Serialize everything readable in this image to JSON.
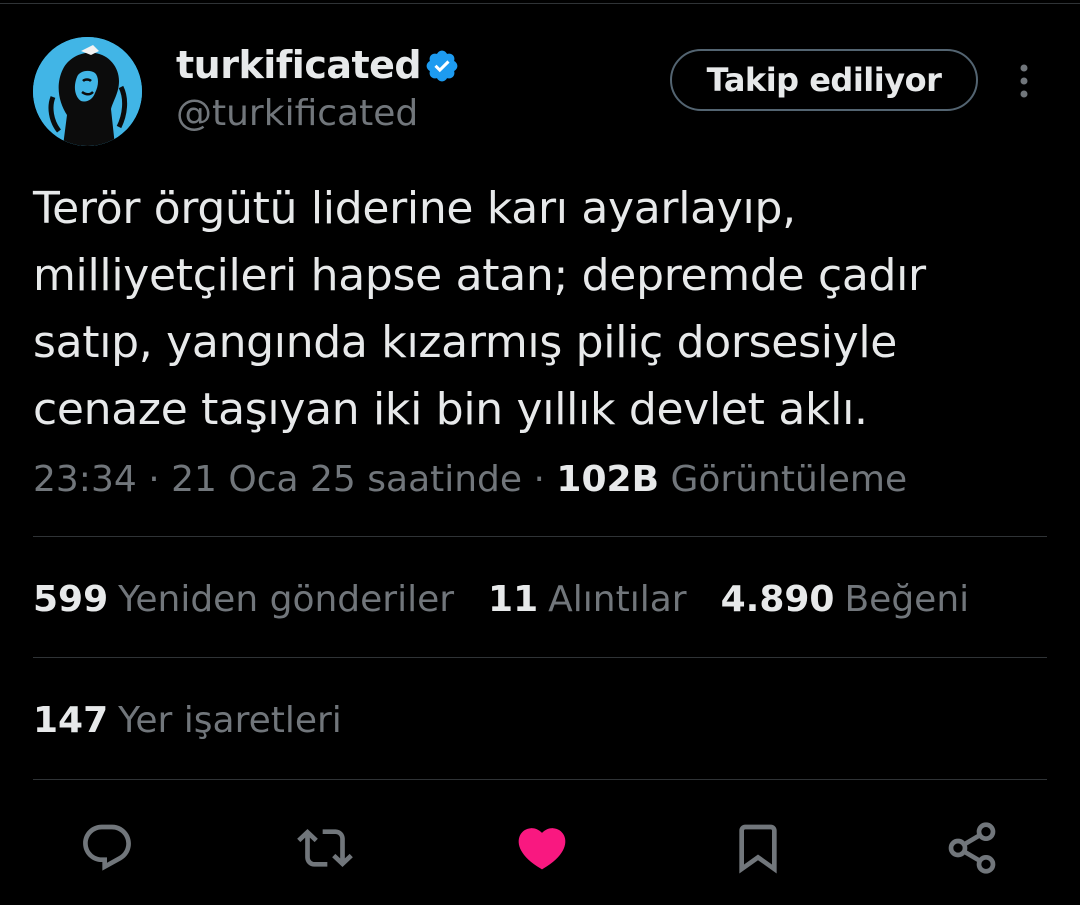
{
  "author": {
    "display_name": "turkificated",
    "handle": "@turkificated",
    "verified": true,
    "avatar_icon": "profile-avatar",
    "avatar_color": "#41b5e6"
  },
  "follow_button": {
    "label": "Takip ediliyor"
  },
  "more_icon": "more-vertical-icon",
  "tweet": {
    "lines": [
      "Terör örgütü liderine karı ayarlayıp,",
      "milliyetçileri hapse atan; depremde çadır",
      "satıp, yangında kızarmış piliç dorsesiyle",
      "cenaze taşıyan iki bin yıllık devlet aklı."
    ]
  },
  "meta": {
    "time": "23:34",
    "separator": "·",
    "date": "21 Oca 25 saatinde",
    "views_count": "102B",
    "views_label": "Görüntüleme"
  },
  "stats": {
    "retweets": {
      "count": "599",
      "label": "Yeniden gönderiler"
    },
    "quotes": {
      "count": "11",
      "label": "Alıntılar"
    },
    "likes": {
      "count": "4.890",
      "label": "Beğeni"
    },
    "bookmarks": {
      "count": "147",
      "label": "Yer işaretleri"
    }
  },
  "actions": {
    "reply_icon": "reply-icon",
    "retweet_icon": "retweet-icon",
    "like_icon": "heart-icon",
    "bookmark_icon": "bookmark-icon",
    "share_icon": "share-icon",
    "like_color": "#f91880"
  },
  "colors": {
    "background": "#000000",
    "text_primary": "#e7e9ea",
    "text_secondary": "#71767b",
    "verified_blue": "#1d9bf0",
    "divider": "#2f3336"
  }
}
